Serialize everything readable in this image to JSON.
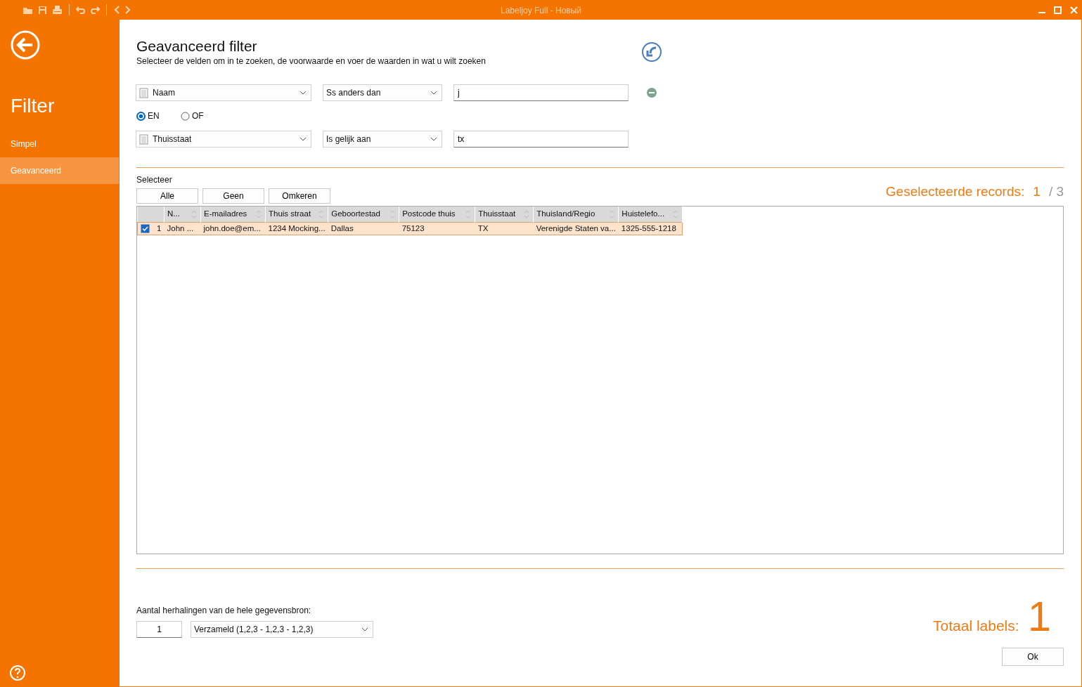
{
  "window": {
    "title": "Labeljoy Full - Новый"
  },
  "sidebar": {
    "title": "Filter",
    "items": [
      {
        "label": "Simpel",
        "selected": false
      },
      {
        "label": "Geavanceerd",
        "selected": true
      }
    ]
  },
  "header": {
    "title": "Geavanceerd filter",
    "subtitle": "Selecteer de velden om in te zoeken, de voorwaarde en voer de waarden in wat u wilt zoeken"
  },
  "conditions": [
    {
      "field": "Naam",
      "operator": "Ss anders dan",
      "value": "j",
      "removable": true
    },
    {
      "field": "Thuisstaat",
      "operator": "Is gelijk aan",
      "value": "tx",
      "removable": false
    }
  ],
  "conjunction": [
    {
      "label": "EN",
      "selected": true
    },
    {
      "label": "OF",
      "selected": false
    }
  ],
  "select": {
    "label": "Selecteer",
    "buttons": [
      "Alle",
      "Geen",
      "Omkeren"
    ]
  },
  "selected_records": {
    "label": "Geselecteerde records:",
    "count": "1",
    "total": "/ 3"
  },
  "table": {
    "columns": [
      "N...",
      "E-mailadres",
      "Thuis straat",
      "Geboortestad",
      "Postcode thuis",
      "Thuisstaat",
      "Thuisland/Regio",
      "Huistelefo..."
    ],
    "rows": [
      {
        "checked": true,
        "index": "1",
        "cells": [
          "John ...",
          "john.doe@em...",
          "1234 Mocking...",
          "Dallas",
          "75123",
          "TX",
          "Verenigde Staten va...",
          "1325-555-1218"
        ]
      }
    ]
  },
  "repeat": {
    "label": "Aantal herhalingen van de hele gegevensbron:",
    "count": "1",
    "mode": "Verzameld (1,2,3 - 1,2,3 - 1,2,3)"
  },
  "total": {
    "label": "Totaal labels:",
    "value": "1"
  },
  "ok_button": "Ok"
}
